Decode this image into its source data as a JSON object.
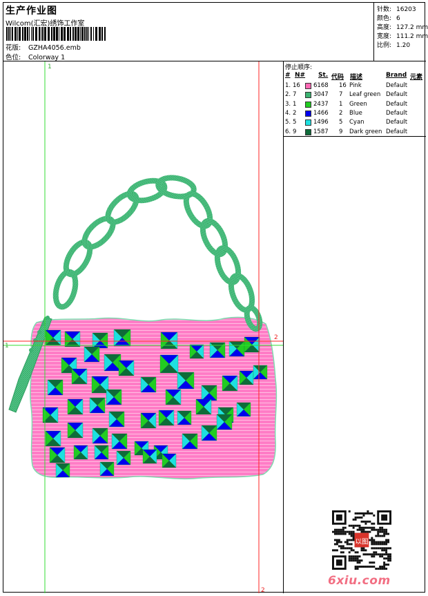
{
  "header": {
    "title": "生产作业图",
    "company": "Wilcom(汇宏)绣饰工作室",
    "design_label": "花版:",
    "design_value": "GZHA4056.emb",
    "colorway_label": "色位:",
    "colorway_value": "Colorway 1"
  },
  "stats": [
    {
      "label": "针数:",
      "value": "16203"
    },
    {
      "label": "颜色:",
      "value": "6"
    },
    {
      "label": "高度:",
      "value": "127.2 mm"
    },
    {
      "label": "宽度:",
      "value": "111.2 mm"
    },
    {
      "label": "比例:",
      "value": "1.20"
    }
  ],
  "guides": {
    "v1": "1",
    "v2": "2",
    "h1": "1",
    "h2": "2",
    "bottom2": "2"
  },
  "stop_sequence": {
    "title": "停止顺序:",
    "headers": {
      "num": "#",
      "needle": "N#",
      "st": "St.",
      "code": "代码",
      "desc": "描述",
      "brand": "Brand",
      "element": "元素"
    },
    "rows": [
      {
        "num": "1.",
        "needle": "16",
        "color": "#ff69b4",
        "st": "6168",
        "code": "16",
        "desc": "Pink",
        "brand": "Default"
      },
      {
        "num": "2.",
        "needle": "7",
        "color": "#3cb371",
        "st": "3047",
        "code": "7",
        "desc": "Leaf green",
        "brand": "Default"
      },
      {
        "num": "3.",
        "needle": "1",
        "color": "#22cc22",
        "st": "2437",
        "code": "1",
        "desc": "Green",
        "brand": "Default"
      },
      {
        "num": "4.",
        "needle": "2",
        "color": "#0000ee",
        "st": "1466",
        "code": "2",
        "desc": "Blue",
        "brand": "Default"
      },
      {
        "num": "5.",
        "needle": "5",
        "color": "#1ee0e0",
        "st": "1496",
        "code": "5",
        "desc": "Cyan",
        "brand": "Default"
      },
      {
        "num": "6.",
        "needle": "9",
        "color": "#0f6b3a",
        "st": "1587",
        "code": "9",
        "desc": "Dark green",
        "brand": "Default"
      }
    ]
  },
  "watermark": {
    "seal_text": "以图",
    "brand_text": "6xiu.com"
  }
}
